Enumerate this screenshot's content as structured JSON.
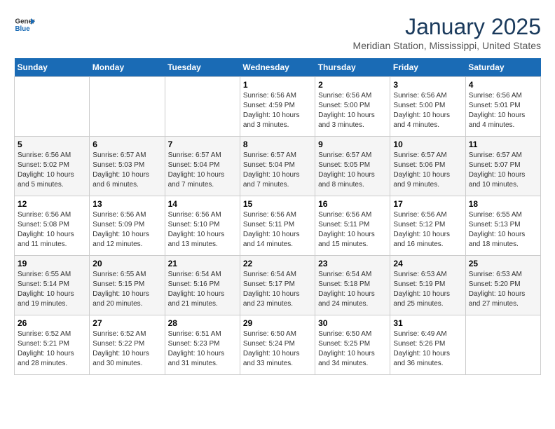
{
  "header": {
    "logo_general": "General",
    "logo_blue": "Blue",
    "month": "January 2025",
    "location": "Meridian Station, Mississippi, United States"
  },
  "weekdays": [
    "Sunday",
    "Monday",
    "Tuesday",
    "Wednesday",
    "Thursday",
    "Friday",
    "Saturday"
  ],
  "weeks": [
    [
      {
        "day": "",
        "sunrise": "",
        "sunset": "",
        "daylight": ""
      },
      {
        "day": "",
        "sunrise": "",
        "sunset": "",
        "daylight": ""
      },
      {
        "day": "",
        "sunrise": "",
        "sunset": "",
        "daylight": ""
      },
      {
        "day": "1",
        "sunrise": "Sunrise: 6:56 AM",
        "sunset": "Sunset: 4:59 PM",
        "daylight": "Daylight: 10 hours and 3 minutes."
      },
      {
        "day": "2",
        "sunrise": "Sunrise: 6:56 AM",
        "sunset": "Sunset: 5:00 PM",
        "daylight": "Daylight: 10 hours and 3 minutes."
      },
      {
        "day": "3",
        "sunrise": "Sunrise: 6:56 AM",
        "sunset": "Sunset: 5:00 PM",
        "daylight": "Daylight: 10 hours and 4 minutes."
      },
      {
        "day": "4",
        "sunrise": "Sunrise: 6:56 AM",
        "sunset": "Sunset: 5:01 PM",
        "daylight": "Daylight: 10 hours and 4 minutes."
      }
    ],
    [
      {
        "day": "5",
        "sunrise": "Sunrise: 6:56 AM",
        "sunset": "Sunset: 5:02 PM",
        "daylight": "Daylight: 10 hours and 5 minutes."
      },
      {
        "day": "6",
        "sunrise": "Sunrise: 6:57 AM",
        "sunset": "Sunset: 5:03 PM",
        "daylight": "Daylight: 10 hours and 6 minutes."
      },
      {
        "day": "7",
        "sunrise": "Sunrise: 6:57 AM",
        "sunset": "Sunset: 5:04 PM",
        "daylight": "Daylight: 10 hours and 7 minutes."
      },
      {
        "day": "8",
        "sunrise": "Sunrise: 6:57 AM",
        "sunset": "Sunset: 5:04 PM",
        "daylight": "Daylight: 10 hours and 7 minutes."
      },
      {
        "day": "9",
        "sunrise": "Sunrise: 6:57 AM",
        "sunset": "Sunset: 5:05 PM",
        "daylight": "Daylight: 10 hours and 8 minutes."
      },
      {
        "day": "10",
        "sunrise": "Sunrise: 6:57 AM",
        "sunset": "Sunset: 5:06 PM",
        "daylight": "Daylight: 10 hours and 9 minutes."
      },
      {
        "day": "11",
        "sunrise": "Sunrise: 6:57 AM",
        "sunset": "Sunset: 5:07 PM",
        "daylight": "Daylight: 10 hours and 10 minutes."
      }
    ],
    [
      {
        "day": "12",
        "sunrise": "Sunrise: 6:56 AM",
        "sunset": "Sunset: 5:08 PM",
        "daylight": "Daylight: 10 hours and 11 minutes."
      },
      {
        "day": "13",
        "sunrise": "Sunrise: 6:56 AM",
        "sunset": "Sunset: 5:09 PM",
        "daylight": "Daylight: 10 hours and 12 minutes."
      },
      {
        "day": "14",
        "sunrise": "Sunrise: 6:56 AM",
        "sunset": "Sunset: 5:10 PM",
        "daylight": "Daylight: 10 hours and 13 minutes."
      },
      {
        "day": "15",
        "sunrise": "Sunrise: 6:56 AM",
        "sunset": "Sunset: 5:11 PM",
        "daylight": "Daylight: 10 hours and 14 minutes."
      },
      {
        "day": "16",
        "sunrise": "Sunrise: 6:56 AM",
        "sunset": "Sunset: 5:11 PM",
        "daylight": "Daylight: 10 hours and 15 minutes."
      },
      {
        "day": "17",
        "sunrise": "Sunrise: 6:56 AM",
        "sunset": "Sunset: 5:12 PM",
        "daylight": "Daylight: 10 hours and 16 minutes."
      },
      {
        "day": "18",
        "sunrise": "Sunrise: 6:55 AM",
        "sunset": "Sunset: 5:13 PM",
        "daylight": "Daylight: 10 hours and 18 minutes."
      }
    ],
    [
      {
        "day": "19",
        "sunrise": "Sunrise: 6:55 AM",
        "sunset": "Sunset: 5:14 PM",
        "daylight": "Daylight: 10 hours and 19 minutes."
      },
      {
        "day": "20",
        "sunrise": "Sunrise: 6:55 AM",
        "sunset": "Sunset: 5:15 PM",
        "daylight": "Daylight: 10 hours and 20 minutes."
      },
      {
        "day": "21",
        "sunrise": "Sunrise: 6:54 AM",
        "sunset": "Sunset: 5:16 PM",
        "daylight": "Daylight: 10 hours and 21 minutes."
      },
      {
        "day": "22",
        "sunrise": "Sunrise: 6:54 AM",
        "sunset": "Sunset: 5:17 PM",
        "daylight": "Daylight: 10 hours and 23 minutes."
      },
      {
        "day": "23",
        "sunrise": "Sunrise: 6:54 AM",
        "sunset": "Sunset: 5:18 PM",
        "daylight": "Daylight: 10 hours and 24 minutes."
      },
      {
        "day": "24",
        "sunrise": "Sunrise: 6:53 AM",
        "sunset": "Sunset: 5:19 PM",
        "daylight": "Daylight: 10 hours and 25 minutes."
      },
      {
        "day": "25",
        "sunrise": "Sunrise: 6:53 AM",
        "sunset": "Sunset: 5:20 PM",
        "daylight": "Daylight: 10 hours and 27 minutes."
      }
    ],
    [
      {
        "day": "26",
        "sunrise": "Sunrise: 6:52 AM",
        "sunset": "Sunset: 5:21 PM",
        "daylight": "Daylight: 10 hours and 28 minutes."
      },
      {
        "day": "27",
        "sunrise": "Sunrise: 6:52 AM",
        "sunset": "Sunset: 5:22 PM",
        "daylight": "Daylight: 10 hours and 30 minutes."
      },
      {
        "day": "28",
        "sunrise": "Sunrise: 6:51 AM",
        "sunset": "Sunset: 5:23 PM",
        "daylight": "Daylight: 10 hours and 31 minutes."
      },
      {
        "day": "29",
        "sunrise": "Sunrise: 6:50 AM",
        "sunset": "Sunset: 5:24 PM",
        "daylight": "Daylight: 10 hours and 33 minutes."
      },
      {
        "day": "30",
        "sunrise": "Sunrise: 6:50 AM",
        "sunset": "Sunset: 5:25 PM",
        "daylight": "Daylight: 10 hours and 34 minutes."
      },
      {
        "day": "31",
        "sunrise": "Sunrise: 6:49 AM",
        "sunset": "Sunset: 5:26 PM",
        "daylight": "Daylight: 10 hours and 36 minutes."
      },
      {
        "day": "",
        "sunrise": "",
        "sunset": "",
        "daylight": ""
      }
    ]
  ]
}
